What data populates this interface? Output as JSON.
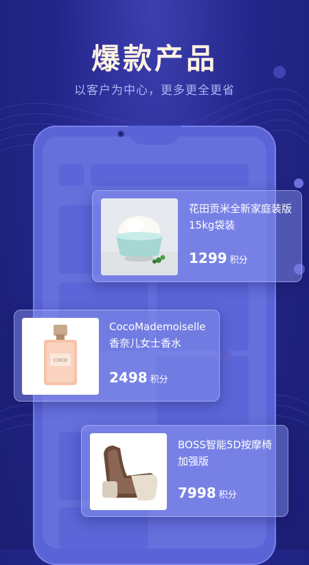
{
  "header": {
    "title": "爆款产品",
    "subtitle": "以客户为中心，更多更全更省"
  },
  "products": [
    {
      "name": "花田贡米全新家庭装版15kg袋装",
      "price": "1299",
      "unit": "积分",
      "image_icon": "rice-bowl-icon"
    },
    {
      "name": "CocoMademoiselle香奈儿女士香水",
      "price": "2498",
      "unit": "积分",
      "image_icon": "perfume-bottle-icon"
    },
    {
      "name": "BOSS智能5D按摩椅加强版",
      "price": "7998",
      "unit": "积分",
      "image_icon": "massage-chair-icon"
    }
  ],
  "colors": {
    "background": "#23268a",
    "title": "#fff2e3",
    "subtitle": "#aeb4f0",
    "phone": "#5a64d6"
  }
}
